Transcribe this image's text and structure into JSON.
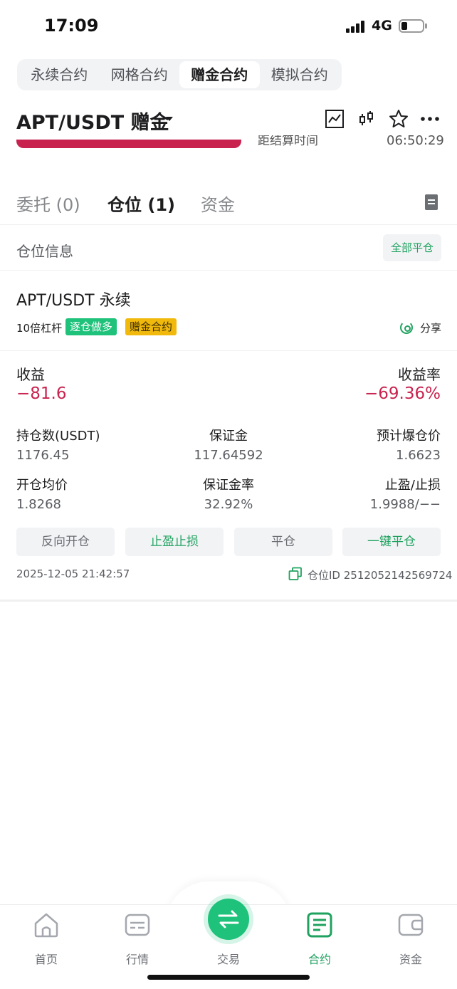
{
  "status": {
    "time": "17:09",
    "network": "4G"
  },
  "mode_tabs": [
    {
      "label": "永续合约"
    },
    {
      "label": "网格合约"
    },
    {
      "label": "赠金合约"
    },
    {
      "label": "模拟合约"
    }
  ],
  "active_mode": "赠金合约",
  "header": {
    "pair": "APT/USDT 赠金"
  },
  "peek": {
    "label": "距结算时间",
    "value": "06:50:29"
  },
  "tabs": {
    "orders": "委托 (0)",
    "positions": "仓位 (1)",
    "funds": "资金"
  },
  "position_info": {
    "label": "仓位信息",
    "close_all": "全部平仓"
  },
  "card": {
    "pair": "APT/USDT 永续",
    "leverage": "10倍杠杆",
    "tag_mode": "逐仓做多",
    "tag_type": "赠金合约",
    "share": "分享",
    "pnl_label": "收益",
    "pnl_value": "−81.6",
    "roe_label": "收益率",
    "roe_value": "−69.36%",
    "size_label": "持仓数(USDT)",
    "size_value": "1176.45",
    "margin_label": "保证金",
    "margin_value": "117.64592",
    "liq_label": "预计爆仓价",
    "liq_value": "1.6623",
    "entry_label": "开仓均价",
    "entry_value": "1.8268",
    "margin_ratio_label": "保证金率",
    "margin_ratio_value": "32.92%",
    "tpsl_label": "止盈/止损",
    "tpsl_value": "1.9988/−−",
    "actions": {
      "reverse": "反向开仓",
      "tpsl": "止盈止损",
      "close": "平仓",
      "quick_close": "一键平仓"
    },
    "timestamp": "2025-12-05 21:42:57",
    "position_id": "仓位ID 2512052142569724"
  },
  "colors": {
    "accent": "#1ec27a",
    "loss": "#c8234e",
    "gift": "#f2b90d"
  },
  "nav": {
    "home": "首页",
    "market": "行情",
    "trade": "交易",
    "contract": "合约",
    "funds": "资金"
  }
}
